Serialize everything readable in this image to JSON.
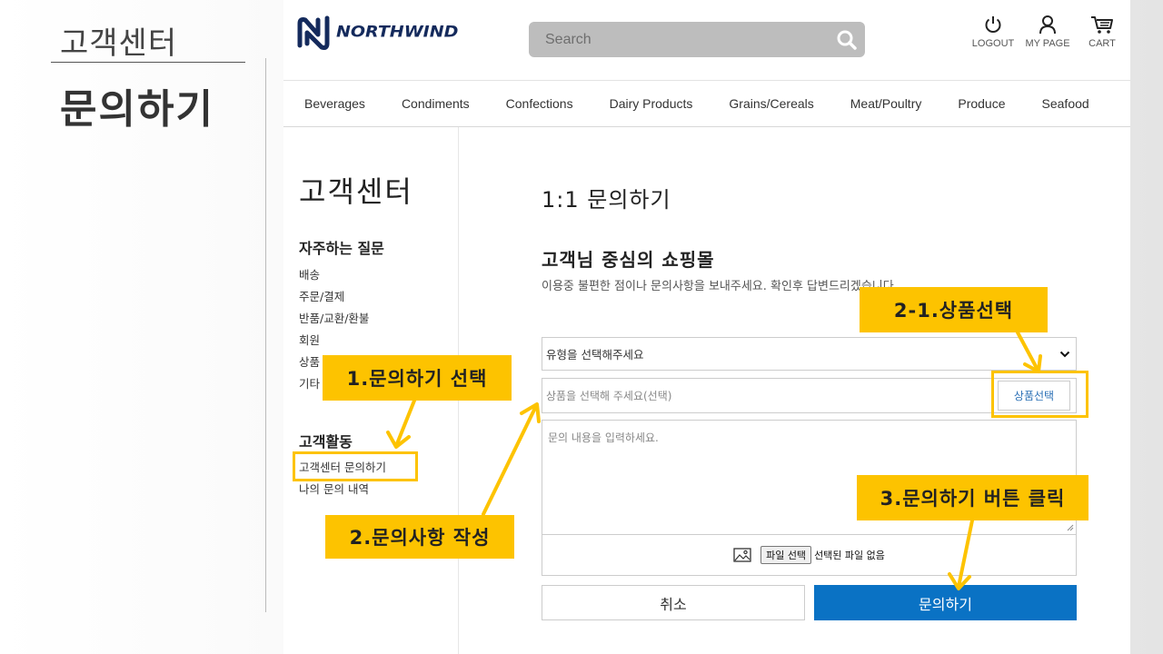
{
  "slide": {
    "subtitle": "고객센터",
    "title": "문의하기"
  },
  "header": {
    "logo_text": "NORTHWIND",
    "search_placeholder": "Search",
    "user_nav": [
      {
        "label": "LOGOUT",
        "icon": "power-icon"
      },
      {
        "label": "MY PAGE",
        "icon": "user-icon"
      },
      {
        "label": "CART",
        "icon": "cart-icon"
      }
    ]
  },
  "categories": [
    "Beverages",
    "Condiments",
    "Confections",
    "Dairy Products",
    "Grains/Cereals",
    "Meat/Poultry",
    "Produce",
    "Seafood"
  ],
  "sidebar": {
    "title": "고객센터",
    "faq_title": "자주하는 질문",
    "faq_items": [
      "배송",
      "주문/결제",
      "반품/교환/환불",
      "회원",
      "상품",
      "기타"
    ],
    "activity_title": "고객활동",
    "activity_items": [
      "고객센터 문의하기",
      "나의 문의 내역"
    ]
  },
  "main": {
    "title": "1:1 문의하기",
    "heading": "고객님 중심의 쇼핑몰",
    "description": "이용중 불편한 점이나 문의사항을 보내주세요. 확인후 답변드리겠습니다.",
    "inquiry_type_placeholder": "유형을 선택해주세요",
    "product_placeholder": "상품을 선택해 주세요(선택)",
    "product_button": "상품선택",
    "content_placeholder": "문의 내용을 입력하세요.",
    "file_button": "파일 선택",
    "file_status": "선택된 파일 없음",
    "cancel_button": "취소",
    "submit_button": "문의하기"
  },
  "callouts": {
    "step1": "1.문의하기 선택",
    "step2": "2.문의사항 작성",
    "step2_1": "2-1.상품선택",
    "step3": "3.문의하기 버튼 클릭"
  },
  "colors": {
    "callout": "#fdc300",
    "submit": "#0a72c4",
    "logo": "#142a5c"
  }
}
